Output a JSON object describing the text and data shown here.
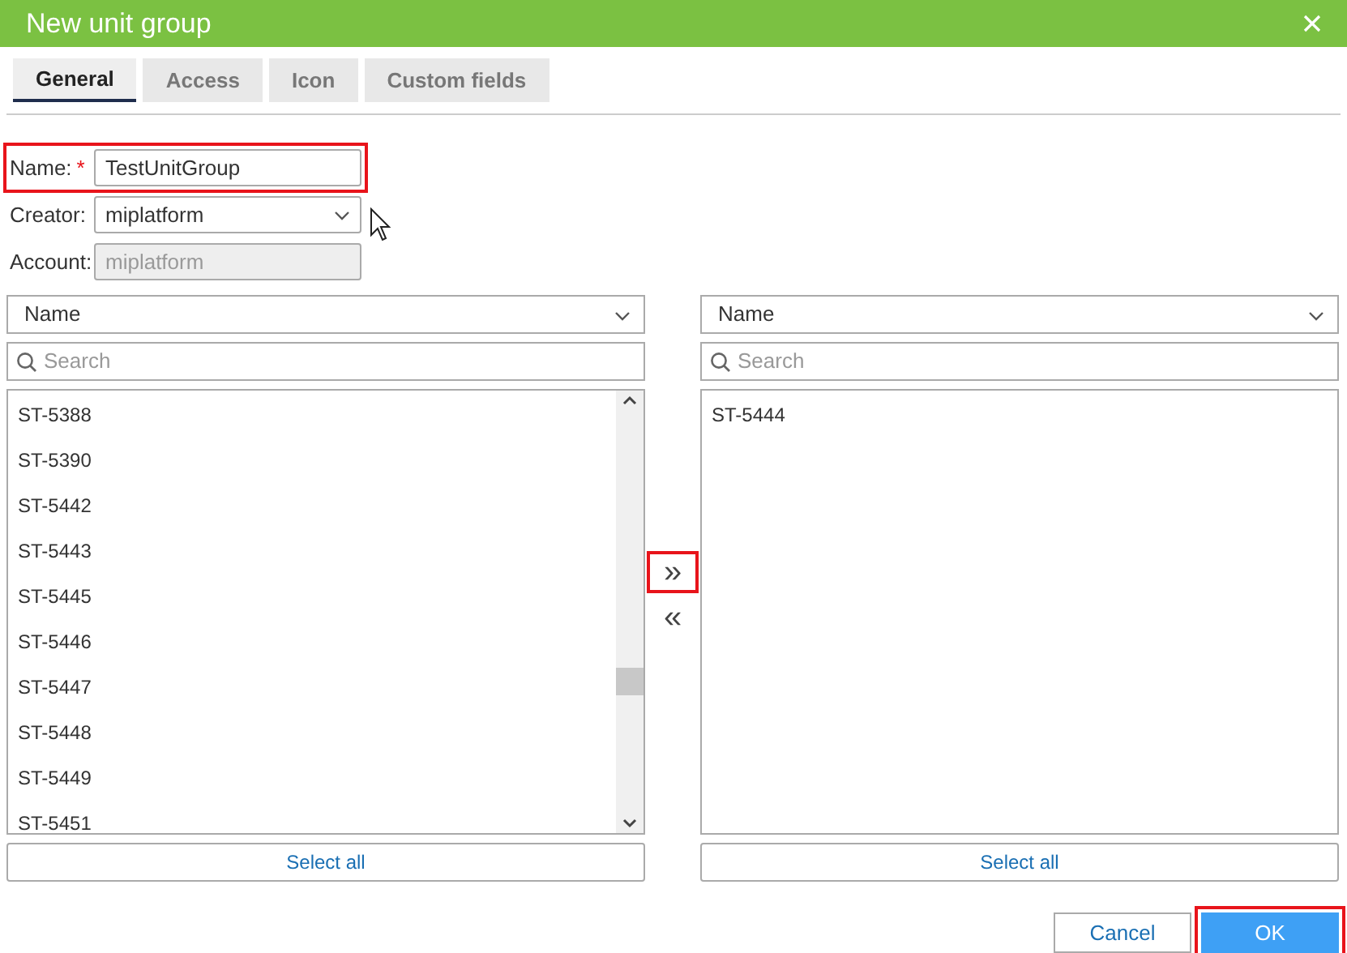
{
  "window": {
    "title": "New unit group"
  },
  "tabs": [
    {
      "label": "General",
      "selected": true
    },
    {
      "label": "Access",
      "selected": false
    },
    {
      "label": "Icon",
      "selected": false
    },
    {
      "label": "Custom fields",
      "selected": false
    }
  ],
  "form": [
    {
      "kind": "text",
      "label": "Name:",
      "required_mark": "*",
      "value": "TestUnitGroup",
      "disabled": false,
      "highlighted": true
    },
    {
      "kind": "select",
      "label": "Creator:",
      "value": "miplatform",
      "disabled": false,
      "highlighted": false
    },
    {
      "kind": "text",
      "label": "Account:",
      "value": "miplatform",
      "disabled": true,
      "highlighted": false
    }
  ],
  "lists": [
    {
      "sort": "Name",
      "search_placeholder": "Search",
      "scrollbar": true,
      "items": [
        "ST-5388",
        "ST-5390",
        "ST-5442",
        "ST-5443",
        "ST-5445",
        "ST-5446",
        "ST-5447",
        "ST-5448",
        "ST-5449",
        "ST-5451"
      ],
      "select_all": "Select all"
    },
    {
      "sort": "Name",
      "search_placeholder": "Search",
      "scrollbar": false,
      "items": [
        "ST-5444"
      ],
      "select_all": "Select all"
    }
  ],
  "transfer": [
    {
      "label": "»",
      "highlighted": true
    },
    {
      "label": "«",
      "highlighted": false
    }
  ],
  "buttons": [
    {
      "label": "Cancel",
      "kind": "secondary",
      "highlighted": false
    },
    {
      "label": "OK",
      "kind": "primary",
      "highlighted": true
    }
  ]
}
